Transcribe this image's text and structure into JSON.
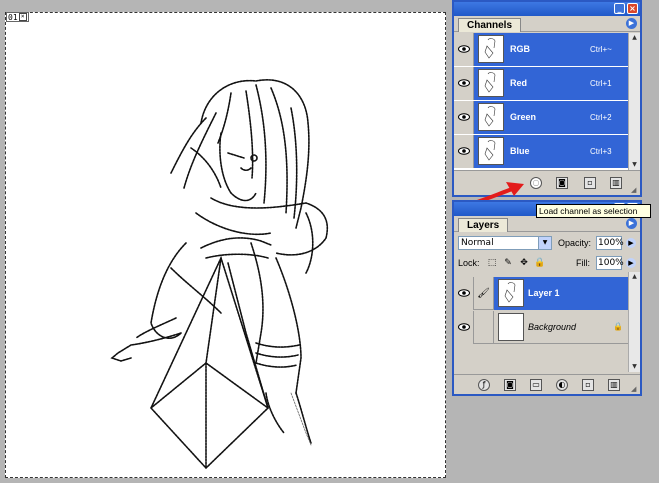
{
  "document": {
    "badge": "01"
  },
  "channels_panel": {
    "tab": "Channels",
    "menu_icon": "panel-menu-icon",
    "rows": [
      {
        "name": "RGB",
        "shortcut": "Ctrl+~"
      },
      {
        "name": "Red",
        "shortcut": "Ctrl+1"
      },
      {
        "name": "Green",
        "shortcut": "Ctrl+2"
      },
      {
        "name": "Blue",
        "shortcut": "Ctrl+3"
      }
    ],
    "footer_buttons": [
      "load-channel-as-selection-icon",
      "save-selection-as-channel-icon",
      "new-channel-icon",
      "delete-channel-icon"
    ]
  },
  "tooltip": {
    "text": "Load channel as selection"
  },
  "layers_panel": {
    "tab": "Layers",
    "blend_mode": "Normal",
    "opacity_label": "Opacity:",
    "opacity_value": "100%",
    "lock_label": "Lock:",
    "fill_label": "Fill:",
    "fill_value": "100%",
    "rows": [
      {
        "name": "Layer 1",
        "selected": true
      },
      {
        "name": "Background",
        "selected": false,
        "locked": true
      }
    ],
    "footer_buttons": [
      "link-icon",
      "layer-style-icon",
      "layer-mask-icon",
      "new-set-icon",
      "adjustment-layer-icon",
      "new-layer-icon",
      "delete-layer-icon"
    ]
  },
  "colors": {
    "titlebar": "#2058c8",
    "selection": "#3265d6",
    "panel_bg": "#d4d0c8",
    "arrow": "#e31b1b",
    "tooltip_bg": "#ffffe1"
  }
}
